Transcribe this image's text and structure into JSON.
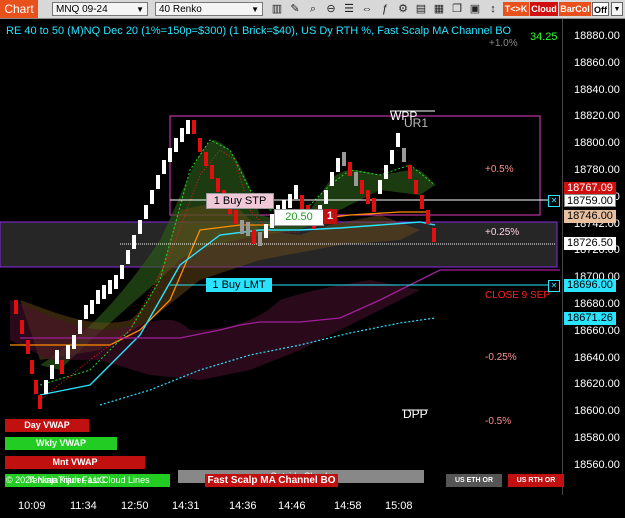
{
  "toolbar": {
    "chart_button": "Chart",
    "instrument": "MNQ 09-24",
    "bar_type": "40 Renko",
    "btn_tk": "T<>K",
    "btn_cloud": "Cloud",
    "btn_barcol": "BarCol",
    "btn_off": "Off"
  },
  "title": "RE 40 to 50 (M)NQ Dec 20 (1%=150p=$300) (1 Brick=$40), US Dy RTH %, Fast Scalp MA Channel BO",
  "y_axis": {
    "ticks": [
      "18880.00",
      "18860.00",
      "18840.00",
      "18820.00",
      "18800.00",
      "18780.00",
      "18760.00",
      "18742.00",
      "18720.00",
      "18700.00",
      "18680.00",
      "18660.00",
      "18640.00",
      "18620.00",
      "18600.00",
      "18580.00",
      "18560.00"
    ]
  },
  "price_boxes": {
    "p1": "18767.09",
    "p2": "18759.00",
    "p3": "18746.00",
    "p4": "18726.50",
    "p5": "18696.00",
    "p6": "18671.26"
  },
  "x_axis": {
    "ticks": [
      "10:09",
      "11:34",
      "12:50",
      "14:31",
      "14:36",
      "14:46",
      "14:58",
      "15:08"
    ]
  },
  "annotations": {
    "top_plus1": "+1.0%",
    "top_right": "34.25",
    "wpp": "WPP",
    "ur1": "UR1",
    "p05": "+0.5%",
    "p025": "+0.25%",
    "close_sep": "CLOSE 9 SEP",
    "m025": "-0.25%",
    "m05": "-0.5%",
    "dpp": "DPP",
    "buy_stp": "1 Buy STP",
    "buy_stp_price": "20.50",
    "buy_stp_qty": "1",
    "buy_lmt": "1 Buy LMT"
  },
  "bottom_labels": {
    "day_vwap": "Day VWAP",
    "wkly_vwap": "Wkly VWAP",
    "mnt_vwap": "Mnt VWAP",
    "copyright": "© 2024 NinjaTrader, LLC",
    "tenkan": "Tenkan Kijun Fast Cloud Lines",
    "outside_clouds": "Outside Clouds",
    "fast_scalp": "Fast Scalp MA Channel BO",
    "us_eth_or": "US ETH OR",
    "us_rth_or": "US RTH OR"
  },
  "colors": {
    "accent_orange": "#e8501c",
    "cyan": "#29e3ff",
    "green": "#00ff00",
    "red": "#d01010",
    "magenta": "#e040c0"
  }
}
